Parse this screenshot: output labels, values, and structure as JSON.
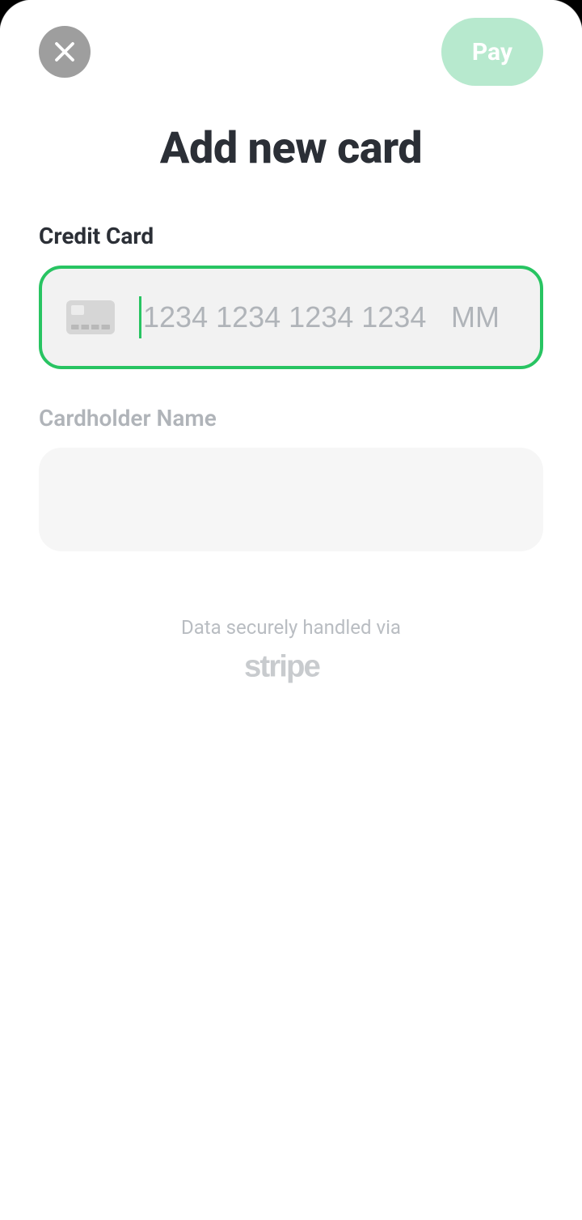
{
  "header": {
    "pay_label": "Pay"
  },
  "title": "Add new card",
  "fields": {
    "credit_card_label": "Credit Card",
    "card_number_placeholder": "1234 1234 1234 1234",
    "card_number_value": "",
    "expiry_placeholder": "MM",
    "expiry_value": "",
    "cardholder_label": "Cardholder Name",
    "cardholder_value": ""
  },
  "footer": {
    "secure_text": "Data securely handled via",
    "provider": "stripe"
  },
  "colors": {
    "accent": "#28c462",
    "pay_bg": "#b7e9ce",
    "close_bg": "#9e9e9e",
    "text": "#2b2f36",
    "muted": "#b0b4b9",
    "input_bg": "#f2f2f2"
  }
}
